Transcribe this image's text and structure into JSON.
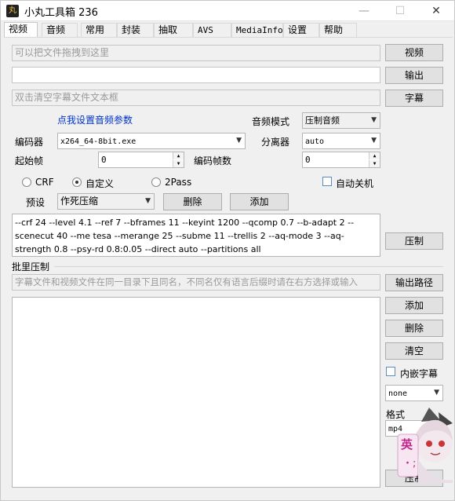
{
  "window": {
    "title": "小丸工具箱 236",
    "app_icon": "丸",
    "minimize": "—",
    "maximize": "☐",
    "close": "✕"
  },
  "tabs": [
    "视频",
    "音频",
    "常用",
    "封装",
    "抽取",
    "AVS",
    "MediaInfo",
    "设置",
    "帮助"
  ],
  "video": {
    "input_video_placeholder": "可以把文件拖拽到这里",
    "btn_video": "视频",
    "output_value": "",
    "btn_output": "输出",
    "subtitle_placeholder": "双击清空字幕文件文本框",
    "btn_subtitle": "字幕",
    "audio_params_link": "点我设置音频参数",
    "audio_mode_label": "音频模式",
    "audio_mode_value": "压制音频",
    "encoder_label": "编码器",
    "encoder_value": "x264_64-8bit.exe",
    "demuxer_label": "分离器",
    "demuxer_value": "auto",
    "start_frame_label": "起始帧",
    "start_frame_value": "0",
    "encode_frames_label": "编码帧数",
    "encode_frames_value": "0",
    "mode_crf": "CRF",
    "mode_custom": "自定义",
    "mode_2pass": "2Pass",
    "auto_shutdown": "自动关机",
    "preset_label": "预设",
    "preset_value": "作死压缩",
    "btn_delete_preset": "删除",
    "btn_add_preset": "添加",
    "params": "--crf 24 --level 4.1 --ref 7 --bframes 11 --keyint 1200 --qcomp 0.7 --b-adapt 2 --scenecut 40 --me tesa --merange 25 --subme 11 --trellis 2 --aq-mode 3 --aq-strength 0.8 --psy-rd 0.8:0.05 --direct auto --partitions all",
    "btn_encode": "压制"
  },
  "batch": {
    "label": "批里压制",
    "hint": "字幕文件和视频文件在同一目录下且同名，不同名仅有语言后缀时请在右方选择或输入",
    "btn_output_path": "输出路径",
    "btn_add": "添加",
    "btn_delete": "删除",
    "btn_clear": "清空",
    "embed_subtitle": "内嵌字幕",
    "lang_value": "none",
    "format_label": "格式",
    "format_value": "mp4",
    "btn_batch_encode": "压制"
  },
  "mascot": {
    "badge": "英",
    "sub": "・;"
  }
}
